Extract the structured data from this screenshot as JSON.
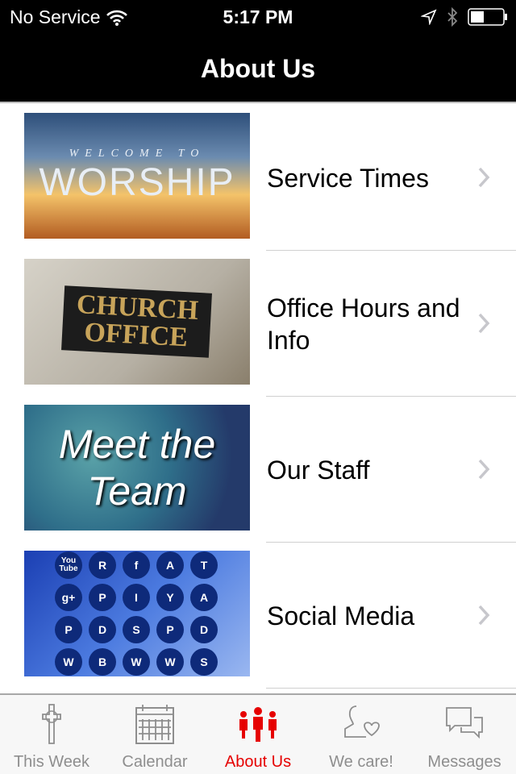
{
  "status": {
    "carrier": "No Service",
    "time": "5:17 PM",
    "battery_level": 0.4
  },
  "nav": {
    "title": "About Us"
  },
  "items": [
    {
      "label": "Service Times",
      "image_text": [
        "WELCOME TO",
        "WORSHIP"
      ]
    },
    {
      "label": "Office Hours and Info",
      "image_text": [
        "CHURCH",
        "OFFICE"
      ]
    },
    {
      "label": "Our Staff",
      "image_text": [
        "Meet the",
        "Team"
      ]
    },
    {
      "label": "Social Media",
      "image_icons": [
        "You Tube",
        "rss",
        "f",
        "android",
        "twitter",
        "g+",
        "photo",
        "instagram",
        "Y",
        "apple",
        "pinterest",
        "drive",
        "S",
        "play",
        "dropbox",
        "whatsapp",
        "B",
        "windows",
        "W",
        "soundcloud"
      ]
    }
  ],
  "tabs": [
    {
      "label": "This Week",
      "icon": "cross-icon"
    },
    {
      "label": "Calendar",
      "icon": "calendar-icon"
    },
    {
      "label": "About Us",
      "icon": "people-icon",
      "active": true
    },
    {
      "label": "We care!",
      "icon": "person-heart-icon"
    },
    {
      "label": "Messages",
      "icon": "chat-bubbles-icon"
    }
  ],
  "colors": {
    "active": "#e60000",
    "inactive": "#8e8e8e",
    "nav_bg": "#000000"
  }
}
